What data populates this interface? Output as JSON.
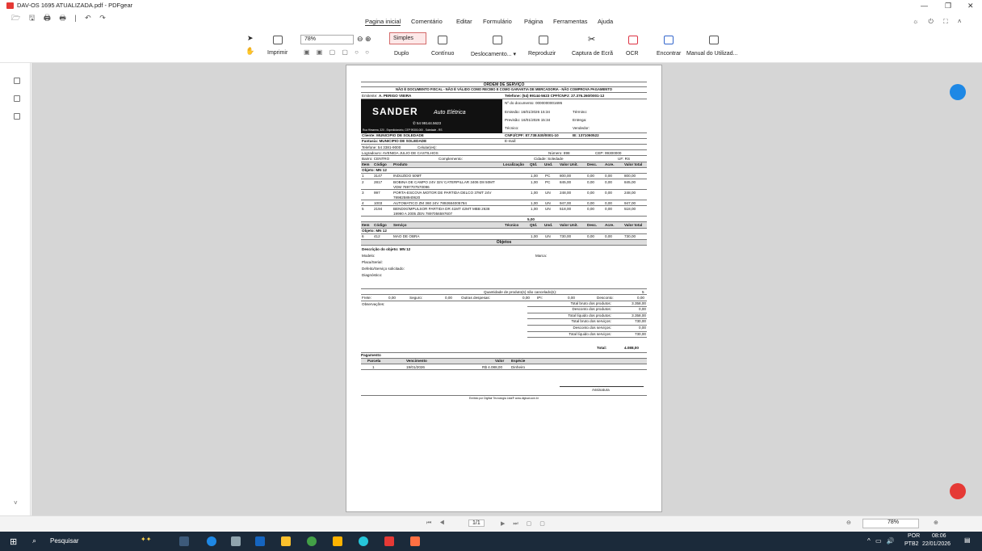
{
  "app": {
    "title": "DAV-OS 1695 ATUALIZADA.pdf - PDFgear",
    "quick_icons": "🗁 🖫 🖨 🖶 | ↶ ↷",
    "window_controls": {
      "minimize": "—",
      "maximize": "❐",
      "close": "✕"
    }
  },
  "menu": {
    "tabs": [
      "Pagina inicial",
      "Comentário",
      "Editar",
      "Formulário",
      "Página",
      "Ferramentas",
      "Ajuda"
    ]
  },
  "ribbon": {
    "print": "Imprimir",
    "zoom": "78%",
    "simples": "Simples",
    "duplo": "Duplo",
    "continuo": "Contínuo",
    "deslocamento": "Deslocamento... ▾",
    "reproduzir": "Reproduzir",
    "captura": "Captura de Ecrã",
    "ocr": "OCR",
    "encontrar": "Encontrar",
    "manual": "Manual do Utilizad..."
  },
  "document": {
    "title": "ORDEM DE SERVIÇO",
    "disclaimer": "NÃO É DOCUMENTO FISCAL - NÃO É VÁLIDO COMO RECIBO E COMO GARANTIA DE MERCADORIA - NÃO COMPROVA PAGAMENTO",
    "emitente_label": "Emitente:",
    "emitente": "A. PERIGO VIEIRA",
    "telefone_line": "Telefone: (54) 99144-5623 CPF/CNPJ: 27.376.260/0001-12",
    "banner_name": "SANDER",
    "banner_script": "Auto Elétrica",
    "banner_phone": "✆ 54 99144.5623",
    "banner_addr": "Rua Himarma, 320 - Expedicionário, CEP 99300-000 - Soledade - RS",
    "num_doc": "Nº do documento:   0000000001695",
    "emissao": "Emissão: 16/01/2026 15:34",
    "termino": "Término:",
    "previsao": "Previsão: 16/01/2026 15:34",
    "entrega": "Entrega:",
    "tecnico": "Técnico:",
    "vendedor": "Vendedor:",
    "cliente": "Cliente:   MUNICIPIO DE SOLEDADE",
    "cnpj": "CNPJ/CPF: 87.738.530/0001-10",
    "ie": "IE: 1371060522",
    "fantasia": "Fantasia: MUNICIPIO DE SOLEDADE",
    "email": "E-mail:",
    "telefone": "Telefone:   54 3381-9000",
    "celular": "Celular(es):",
    "logradouro": "Logradouro:   AVENIDA JULIO DE CASTILHOS",
    "numero": "Número:  898",
    "cep": "CEP:  99300000",
    "bairro": "Bairro:   CENTRO",
    "complemento": "Complemento:",
    "cidade": "Cidade:  Soledade",
    "uf": "UF:  RS",
    "prod_headers": [
      "Item",
      "Código",
      "Produto",
      "Localização",
      "Qtd.",
      "Und.",
      "Valor Unit.",
      "Desc.",
      "Acre.",
      "Valor total"
    ],
    "objeto": "Objeto:  MN 12",
    "produtos": [
      [
        "1",
        "3147",
        "INDUZIDO 50MT",
        "",
        "1,00",
        "PC",
        "800,00",
        "0,00",
        "0,00",
        "800,00"
      ],
      [
        "2",
        "2817",
        "BOBINA DE CAMPO 24V 32V CATERPILLAR 3406 D8 50MT VDM 7897707570096",
        "",
        "1,00",
        "PC",
        "845,00",
        "0,00",
        "0,00",
        "845,00"
      ],
      [
        "3",
        "997",
        "PORTA-ESCOVA MOTOR DE PARTIDA DELCO 37MT 24V 7898258940620",
        "",
        "1,00",
        "UN",
        "248,00",
        "0,00",
        "0,00",
        "248,00"
      ],
      [
        "4",
        "1003",
        "AUTOMATICO ZM 360 24V 7892684005784",
        "",
        "1,00",
        "UN",
        "947,00",
        "0,00",
        "0,00",
        "947,00"
      ],
      [
        "5",
        "2194",
        "BENDIX/IMPULSOR PARTIDA DR 41MT 42MT MBB 2638 19990 A 2005 ZEN 7897056597607",
        "",
        "1,00",
        "UN",
        "518,00",
        "0,00",
        "0,00",
        "518,00"
      ]
    ],
    "qtd_total": "5,00",
    "serv_headers": [
      "Item",
      "Código",
      "Serviço",
      "Técnico",
      "Qtd.",
      "Und.",
      "Valor Unit.",
      "Desc.",
      "Acre.",
      "Valor total"
    ],
    "servicos": [
      [
        "6",
        "412",
        "MAO DE OBRA",
        "",
        "1,00",
        "UN",
        "730,00",
        "0,00",
        "0,00",
        "730,00"
      ]
    ],
    "objetos_title": "Objetos",
    "desc_objeto": "Descrição do objeto:   MN 12",
    "modelo": "Modelo:",
    "marca": "Marca:",
    "placa": "Placa/Serial:",
    "defeito": "Defeito/Serviço solicitado:",
    "diagnostico": "Diagnóstico:",
    "qtd_nao_cancel": "Quantidade de produto(s) não cancelado(s):",
    "qtd_nao_cancel_val": "5",
    "frete": "Frete:",
    "frete_v": "0,00",
    "seguro": "Seguro:",
    "seguro_v": "0,00",
    "outras": "Outras despesas:",
    "outras_v": "0,00",
    "ipi": "IPI:",
    "ipi_v": "0,00",
    "desconto": "Desconto:",
    "desconto_v": "0,00",
    "observacoes": "Observações:",
    "totais": [
      [
        "Total bruto dos produtos:",
        "3.358,00"
      ],
      [
        "Desconto dos produtos:",
        "0,00"
      ],
      [
        "Total líquido dos produtos:",
        "3.358,00"
      ],
      [
        "Total bruto dos serviços:",
        "730,00"
      ],
      [
        "Desconto dos serviços:",
        "0,00"
      ],
      [
        "Total líquido dos serviços:",
        "730,00"
      ]
    ],
    "total_label": "Total:",
    "total_val": "4.088,00",
    "pagamento": "Pagamento",
    "pag_headers": [
      "Parcela",
      "Vencimento",
      "Valor",
      "Espécie"
    ],
    "pag_row": [
      "1",
      "19/01/2026",
      "R$ 4.088,00",
      "Dinheiro"
    ],
    "assinatura": "Assinatura",
    "footer": "Emitido por Digifair Tecnologia Ltda® www.digisat.com.br"
  },
  "statusbar": {
    "page": "1/1",
    "zoom": "78%"
  },
  "taskbar": {
    "search": "Pesquisar",
    "lang": "POR",
    "lang2": "PTB2",
    "time": "08:06",
    "date": "22/01/2026"
  }
}
